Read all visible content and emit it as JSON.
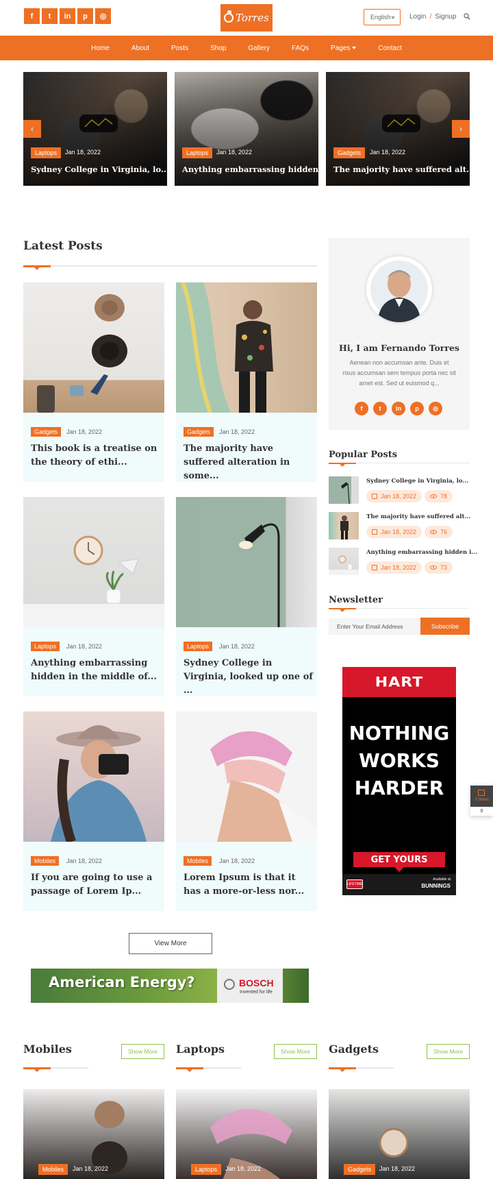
{
  "header": {
    "social": [
      {
        "icon": "facebook-icon",
        "glyph": "f"
      },
      {
        "icon": "twitter-icon",
        "glyph": "t"
      },
      {
        "icon": "linkedin-icon",
        "glyph": "in"
      },
      {
        "icon": "pinterest-icon",
        "glyph": "p"
      },
      {
        "icon": "dribbble-icon",
        "glyph": "◎"
      }
    ],
    "logo_text": "Torres",
    "language": "English",
    "login": "Login",
    "separator": "/",
    "signup": "Signup"
  },
  "nav": {
    "items": [
      "Home",
      "About",
      "Posts",
      "Shop",
      "Gallery",
      "FAQs",
      "Pages",
      "Contact"
    ]
  },
  "slider": {
    "prev_arrow": "‹",
    "next_arrow": "›",
    "slides": [
      {
        "tag": "Laptops",
        "date": "Jan 18, 2022",
        "title": "Sydney College in Virginia, lo..."
      },
      {
        "tag": "Laptops",
        "date": "Jan 18, 2022",
        "title": "Anything embarrassing hidden i..."
      },
      {
        "tag": "Gadgets",
        "date": "Jan 18, 2022",
        "title": "The majority have suffered alt..."
      }
    ]
  },
  "latest": {
    "title": "Latest Posts",
    "posts": [
      {
        "tag": "Gadgets",
        "date": "Jan 18, 2022",
        "title": "This book is a treatise on the theory of ethi..."
      },
      {
        "tag": "Gadgets",
        "date": "Jan 18, 2022",
        "title": "The majority have suffered alteration in some..."
      },
      {
        "tag": "Laptops",
        "date": "Jan 18, 2022",
        "title": "Anything embarrassing hidden in the middle of..."
      },
      {
        "tag": "Laptops",
        "date": "Jan 18, 2022",
        "title": "Sydney College in Virginia, looked up one of ..."
      },
      {
        "tag": "Mobiles",
        "date": "Jan 18, 2022",
        "title": "If you are going to use a passage of Lorem Ip..."
      },
      {
        "tag": "Mobiles",
        "date": "Jan 18, 2022",
        "title": "Lorem Ipsum is that it has a more-or-less nor..."
      }
    ],
    "view_more": "View More"
  },
  "author": {
    "name": "Hi, I am Fernando Torres",
    "bio": "Aenean non accumsan ante. Duis et risus accumsan sem tempus porta nec sit amet est. Sed ut euismod q...",
    "social": [
      {
        "icon": "facebook-icon",
        "glyph": "f"
      },
      {
        "icon": "twitter-icon",
        "glyph": "t"
      },
      {
        "icon": "linkedin-icon",
        "glyph": "in"
      },
      {
        "icon": "pinterest-icon",
        "glyph": "p"
      },
      {
        "icon": "dribbble-icon",
        "glyph": "◎"
      }
    ]
  },
  "popular": {
    "title": "Popular Posts",
    "items": [
      {
        "title": "Sydney College in Virginia, lo...",
        "date": "Jan 18, 2022",
        "views": "78"
      },
      {
        "title": "The majority have suffered alt...",
        "date": "Jan 18, 2022",
        "views": "76"
      },
      {
        "title": "Anything embarrassing hidden i...",
        "date": "Jan 18, 2022",
        "views": "73"
      }
    ]
  },
  "newsletter": {
    "title": "Newsletter",
    "placeholder": "Enter Your Email Address",
    "button": "Subscribe"
  },
  "ad_tall": {
    "brand": "HART",
    "lines": [
      "NOTHING",
      "WORKS",
      "HARDER"
    ],
    "cta": "GET YOURS",
    "foot_left": "LIFETIME",
    "foot_right_small": "Available at",
    "foot_right": "BUNNINGS"
  },
  "ad_wide": {
    "headline": "American Energy?",
    "brand": "BOSCH",
    "tagline": "Invented for life"
  },
  "cart": {
    "label": "0 Items",
    "count": "0"
  },
  "categories": [
    {
      "title": "Mobiles",
      "button": "Show More",
      "tag": "Mobiles",
      "date": "Jan 18, 2022"
    },
    {
      "title": "Laptops",
      "button": "Show More",
      "tag": "Laptops",
      "date": "Jan 18, 2022"
    },
    {
      "title": "Gadgets",
      "button": "Show More",
      "tag": "Gadgets",
      "date": "Jan 18, 2022"
    }
  ],
  "colors": {
    "accent": "#ee7024",
    "card_bg": "#f0fbfc",
    "show_more": "#8bc34a"
  }
}
